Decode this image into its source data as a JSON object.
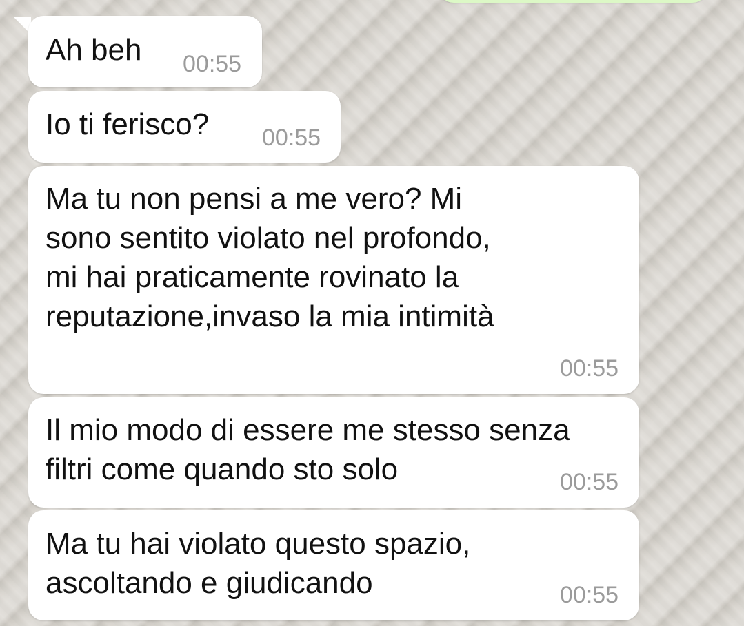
{
  "messages": [
    {
      "text": "Ah beh",
      "time": "00:55"
    },
    {
      "text": "Io ti ferisco?",
      "time": "00:55"
    },
    {
      "text": "Ma tu non pensi a me vero? Mi\nsono sentito violato nel profondo,\nmi hai praticamente rovinato la\nreputazione,invaso la mia intimità",
      "time": "00:55"
    },
    {
      "text": "Il mio modo di essere me stesso senza\nfiltri come quando sto solo",
      "time": "00:55"
    },
    {
      "text": "Ma tu hai violato questo spazio,\nascoltando e giudicando",
      "time": "00:55"
    }
  ],
  "colors": {
    "incoming_bubble": "#ffffff",
    "outgoing_bubble": "#dcf8c6",
    "timestamp": "#9b9b9b"
  }
}
